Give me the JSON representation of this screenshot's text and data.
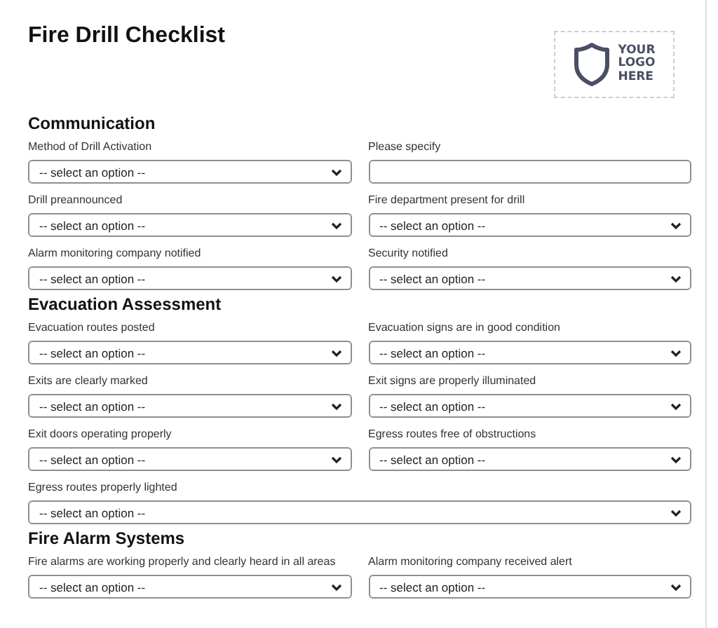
{
  "title": "Fire Drill Checklist",
  "logo": {
    "text": [
      "YOUR",
      "LOGO",
      "HERE"
    ]
  },
  "sections": [
    {
      "heading": "Communication",
      "fields": [
        {
          "label": "Method of Drill Activation",
          "kind": "select",
          "value": "-- select an option --"
        },
        {
          "label": "Please specify",
          "kind": "text"
        },
        {
          "label": "Drill preannounced",
          "kind": "select",
          "value": "-- select an option --"
        },
        {
          "label": "Fire department present for drill",
          "kind": "select",
          "value": "-- select an option --"
        },
        {
          "label": "Alarm monitoring company notified",
          "kind": "select",
          "value": "-- select an option --"
        },
        {
          "label": "Security notified",
          "kind": "select",
          "value": "-- select an option --"
        }
      ]
    },
    {
      "heading": "Evacuation Assessment",
      "fields": [
        {
          "label": "Evacuation routes posted",
          "kind": "select",
          "value": "-- select an option --"
        },
        {
          "label": "Evacuation signs are in good condition",
          "kind": "select",
          "value": "-- select an option --"
        },
        {
          "label": "Exits are clearly marked",
          "kind": "select",
          "value": "-- select an option --"
        },
        {
          "label": "Exit signs are properly illuminated",
          "kind": "select",
          "value": "-- select an option --"
        },
        {
          "label": "Exit doors operating properly",
          "kind": "select",
          "value": "-- select an option --"
        },
        {
          "label": "Egress routes free of obstructions",
          "kind": "select",
          "value": "-- select an option --"
        },
        {
          "label": "Egress routes properly lighted",
          "kind": "select",
          "value": "-- select an option --",
          "full": true
        }
      ]
    },
    {
      "heading": "Fire Alarm Systems",
      "fields": [
        {
          "label": "Fire alarms are working properly and clearly heard in all areas",
          "kind": "select",
          "value": "-- select an option --"
        },
        {
          "label": "Alarm monitoring company received alert",
          "kind": "select",
          "value": "-- select an option --"
        }
      ]
    }
  ]
}
